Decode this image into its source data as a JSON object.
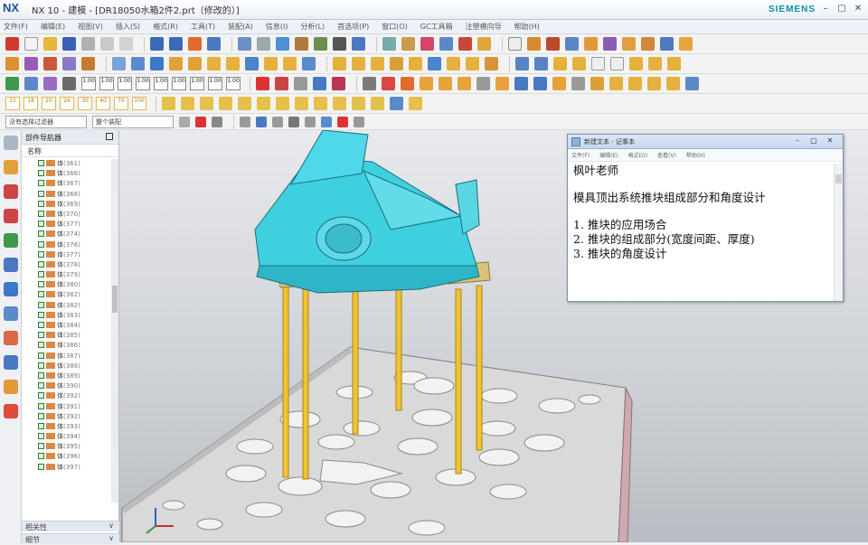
{
  "window": {
    "app_logo": "NX",
    "title": "NX 10 - 建模 - [DR18050水箱2件2.prt（修改的）]",
    "brand": "SIEMENS",
    "controls": [
      "–",
      "▢",
      "✕"
    ]
  },
  "menubar": [
    "文件(F)",
    "编辑(E)",
    "视图(V)",
    "插入(S)",
    "格式(R)",
    "工具(T)",
    "装配(A)",
    "信息(I)",
    "分析(L)",
    "首选项(P)",
    "窗口(O)",
    "GC工具箱",
    "注塑模向导",
    "帮助(H)"
  ],
  "toolbar": {
    "weight_labels": [
      "10",
      "18",
      "20",
      "26",
      "30",
      "40",
      "70",
      "100"
    ],
    "measure_labels": [
      "1.00",
      "1.00",
      "1.00",
      "1.00",
      "1.00",
      "1.00",
      "1.00",
      "1.00",
      "1.00"
    ],
    "filter_left": "没有选择过滤器",
    "filter_right": "整个装配"
  },
  "navigator": {
    "title": "部件导航器",
    "column": "名称",
    "items": [
      {
        "label": "体",
        "num": "(361)"
      },
      {
        "label": "体",
        "num": "(366)"
      },
      {
        "label": "体",
        "num": "(367)"
      },
      {
        "label": "体",
        "num": "(368)"
      },
      {
        "label": "体",
        "num": "(369)"
      },
      {
        "label": "体",
        "num": "(370)"
      },
      {
        "label": "体",
        "num": "(377)"
      },
      {
        "label": "体",
        "num": "(374)"
      },
      {
        "label": "体",
        "num": "(376)"
      },
      {
        "label": "体",
        "num": "(377)"
      },
      {
        "label": "体",
        "num": "(378)"
      },
      {
        "label": "体",
        "num": "(379)"
      },
      {
        "label": "体",
        "num": "(380)"
      },
      {
        "label": "体",
        "num": "(382)"
      },
      {
        "label": "体",
        "num": "(382)"
      },
      {
        "label": "体",
        "num": "(383)"
      },
      {
        "label": "体",
        "num": "(384)"
      },
      {
        "label": "体",
        "num": "(385)"
      },
      {
        "label": "体",
        "num": "(386)"
      },
      {
        "label": "体",
        "num": "(387)"
      },
      {
        "label": "体",
        "num": "(388)"
      },
      {
        "label": "体",
        "num": "(389)"
      },
      {
        "label": "体",
        "num": "(390)"
      },
      {
        "label": "体",
        "num": "(392)"
      },
      {
        "label": "体",
        "num": "(391)"
      },
      {
        "label": "体",
        "num": "(392)"
      },
      {
        "label": "体",
        "num": "(393)"
      },
      {
        "label": "体",
        "num": "(394)"
      },
      {
        "label": "体",
        "num": "(395)"
      },
      {
        "label": "体",
        "num": "(396)"
      },
      {
        "label": "体",
        "num": "(397)"
      }
    ],
    "footer1": "相关性",
    "footer2": "细节"
  },
  "notepad": {
    "title": "新建文本 - 记事本",
    "menu": [
      "文件(F)",
      "编辑(E)",
      "格式(O)",
      "查看(V)",
      "帮助(H)"
    ],
    "lines": [
      "枫叶老师",
      "",
      "模具顶出系统推块组成部分和角度设计",
      "",
      "1. 推块的应用场合",
      "2. 推块的组成部分(宽度间距、厚度)",
      "3. 推块的角度设计"
    ]
  },
  "colors": {
    "part_cyan": "#3fd0e0",
    "pin_yellow": "#f2c230",
    "plate_gray": "#d9d9d9",
    "brand_teal": "#0a8fa0"
  }
}
